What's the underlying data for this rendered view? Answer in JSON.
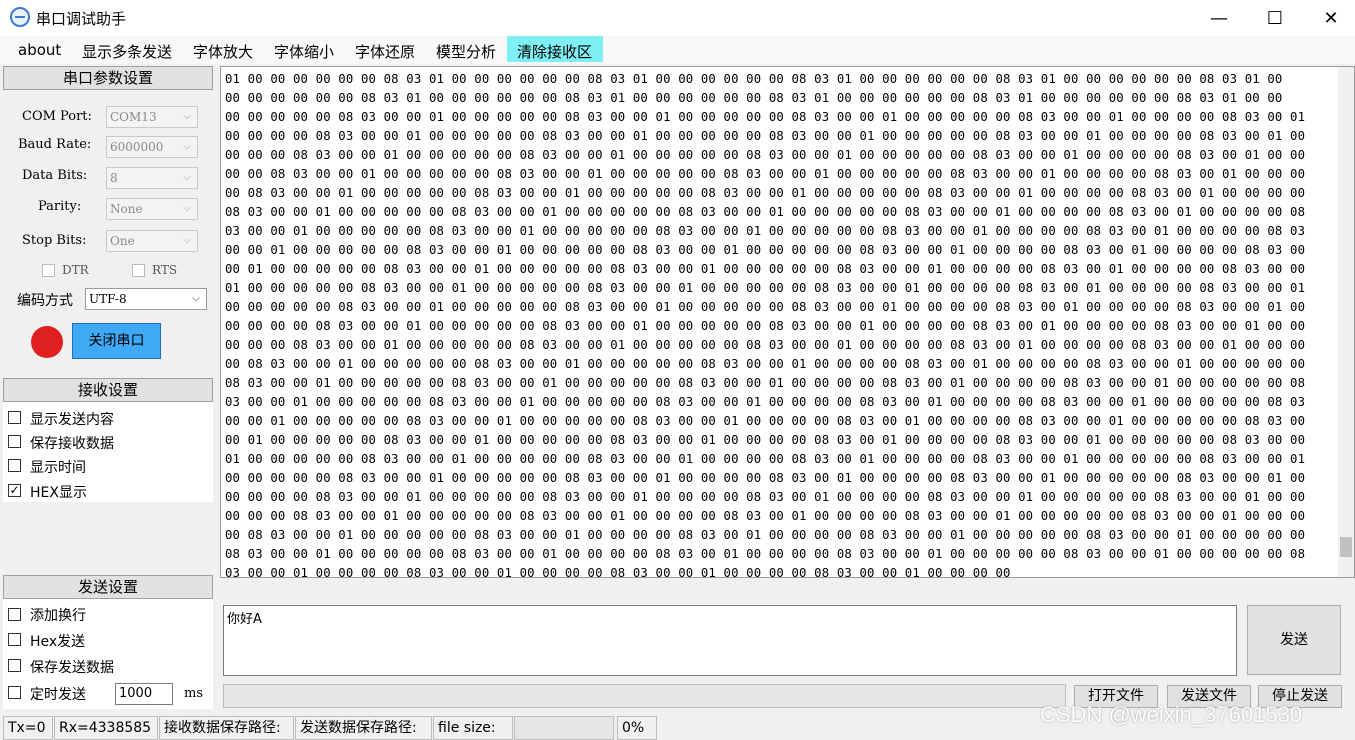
{
  "window": {
    "title": "串口调试助手",
    "minimize": "—",
    "maximize": "☐",
    "close": "✕"
  },
  "menu": [
    "about",
    "显示多条发送",
    "字体放大",
    "字体缩小",
    "字体还原",
    "模型分析",
    "清除接收区"
  ],
  "serial_settings": {
    "header": "串口参数设置",
    "com_port_label": "COM Port:",
    "com_port_value": "COM13",
    "baud_rate_label": "Baud Rate:",
    "baud_rate_value": "6000000",
    "data_bits_label": "Data Bits:",
    "data_bits_value": "8",
    "parity_label": "Parity:",
    "parity_value": "None",
    "stop_bits_label": "Stop Bits:",
    "stop_bits_value": "One",
    "dtr_label": "DTR",
    "rts_label": "RTS",
    "encoding_label": "编码方式",
    "encoding_value": "UTF-8",
    "close_port_button": "关闭串口",
    "status_color": "#e02020"
  },
  "receive_settings": {
    "header": "接收设置",
    "options": [
      {
        "label": "显示发送内容",
        "checked": false
      },
      {
        "label": "保存接收数据",
        "checked": false
      },
      {
        "label": "显示时间",
        "checked": false
      },
      {
        "label": "HEX显示",
        "checked": true
      }
    ]
  },
  "send_settings": {
    "header": "发送设置",
    "options": [
      {
        "label": "添加换行",
        "checked": false
      },
      {
        "label": "Hex发送",
        "checked": false
      },
      {
        "label": "保存发送数据",
        "checked": false
      },
      {
        "label": "定时发送",
        "checked": false
      }
    ],
    "interval_value": "1000",
    "interval_unit": "ms"
  },
  "receive_area": {
    "lines": [
      "01 00 00 00 00 00 00 08 03 01 00 00 00 00 00 00 08 03 01 00 00 00 00 00 00 08 03 01 00 00 00 00 00 00 08 03 01 00 00 00 00 00 00 08 03 01 00",
      "00 00 00 00 00 00 08 03 01 00 00 00 00 00 00 08 03 01 00 00 00 00 00 00 08 03 01 00 00 00 00 00 00 08 03 01 00 00 00 00 00 00 08 03 01 00 00",
      "00 00 00 00 00 08 03 00 00 01 00 00 00 00 00 08 03 00 00 01 00 00 00 00 00 08 03 00 00 01 00 00 00 00 00 08 03 00 00 01 00 00 00 00 08 03 00 01",
      "00 00 00 00 08 03 00 00 01 00 00 00 00 00 08 03 00 00 01 00 00 00 00 00 08 03 00 00 01 00 00 00 00 00 08 03 00 00 01 00 00 00 00 08 03 00 01 00",
      "00 00 00 08 03 00 00 01 00 00 00 00 00 08 03 00 00 01 00 00 00 00 00 08 03 00 00 01 00 00 00 00 00 08 03 00 00 01 00 00 00 00 08 03 00 01 00 00",
      "00 00 08 03 00 00 01 00 00 00 00 00 08 03 00 00 01 00 00 00 00 00 08 03 00 00 01 00 00 00 00 00 08 03 00 00 01 00 00 00 00 08 03 00 01 00 00 00",
      "00 08 03 00 00 01 00 00 00 00 00 08 03 00 00 01 00 00 00 00 00 08 03 00 00 01 00 00 00 00 00 08 03 00 00 01 00 00 00 00 08 03 00 01 00 00 00 00",
      "08 03 00 00 01 00 00 00 00 00 08 03 00 00 01 00 00 00 00 00 08 03 00 00 01 00 00 00 00 00 08 03 00 00 01 00 00 00 00 08 03 00 01 00 00 00 00 08",
      "03 00 00 01 00 00 00 00 00 08 03 00 00 01 00 00 00 00 00 08 03 00 00 01 00 00 00 00 00 08 03 00 00 01 00 00 00 00 08 03 00 01 00 00 00 00 08 03",
      "00 00 01 00 00 00 00 00 08 03 00 00 01 00 00 00 00 00 08 03 00 00 01 00 00 00 00 00 08 03 00 00 01 00 00 00 00 08 03 00 01 00 00 00 00 08 03 00",
      "00 01 00 00 00 00 00 08 03 00 00 01 00 00 00 00 00 08 03 00 00 01 00 00 00 00 00 08 03 00 00 01 00 00 00 00 08 03 00 01 00 00 00 00 08 03 00 00",
      "01 00 00 00 00 00 08 03 00 00 01 00 00 00 00 00 08 03 00 00 01 00 00 00 00 00 08 03 00 00 01 00 00 00 00 08 03 00 01 00 00 00 00 08 03 00 00 01",
      "00 00 00 00 00 08 03 00 00 01 00 00 00 00 00 08 03 00 00 01 00 00 00 00 00 08 03 00 00 01 00 00 00 00 08 03 00 01 00 00 00 00 08 03 00 00 01 00",
      "00 00 00 00 08 03 00 00 01 00 00 00 00 00 08 03 00 00 01 00 00 00 00 00 08 03 00 00 01 00 00 00 00 08 03 00 01 00 00 00 00 08 03 00 00 01 00 00",
      "00 00 00 08 03 00 00 01 00 00 00 00 00 08 03 00 00 01 00 00 00 00 00 08 03 00 00 01 00 00 00 00 08 03 00 01 00 00 00 00 08 03 00 00 01 00 00 00",
      "00 08 03 00 00 01 00 00 00 00 00 08 03 00 00 01 00 00 00 00 00 08 03 00 00 01 00 00 00 00 08 03 00 01 00 00 00 00 08 03 00 00 01 00 00 00 00 00",
      "08 03 00 00 01 00 00 00 00 00 08 03 00 00 01 00 00 00 00 00 08 03 00 00 01 00 00 00 00 08 03 00 01 00 00 00 00 08 03 00 00 01 00 00 00 00 00 08",
      "03 00 00 01 00 00 00 00 00 08 03 00 00 01 00 00 00 00 00 08 03 00 00 01 00 00 00 00 08 03 00 01 00 00 00 00 08 03 00 00 01 00 00 00 00 00 08 03",
      "00 00 01 00 00 00 00 00 08 03 00 00 01 00 00 00 00 00 08 03 00 00 01 00 00 00 00 08 03 00 01 00 00 00 00 08 03 00 00 01 00 00 00 00 00 08 03 00",
      "00 01 00 00 00 00 00 08 03 00 00 01 00 00 00 00 00 08 03 00 00 01 00 00 00 00 08 03 00 01 00 00 00 00 08 03 00 00 01 00 00 00 00 00 08 03 00 00",
      "01 00 00 00 00 00 08 03 00 00 01 00 00 00 00 00 08 03 00 00 01 00 00 00 00 08 03 00 01 00 00 00 00 08 03 00 00 01 00 00 00 00 00 08 03 00 00 01",
      "00 00 00 00 00 08 03 00 00 01 00 00 00 00 00 08 03 00 00 01 00 00 00 00 08 03 00 01 00 00 00 00 08 03 00 00 01 00 00 00 00 00 08 03 00 00 01 00",
      "00 00 00 00 08 03 00 00 01 00 00 00 00 00 08 03 00 00 01 00 00 00 00 08 03 00 01 00 00 00 00 08 03 00 00 01 00 00 00 00 00 08 03 00 00 01 00 00",
      "00 00 00 08 03 00 00 01 00 00 00 00 00 08 03 00 00 01 00 00 00 00 08 03 00 01 00 00 00 00 08 03 00 00 01 00 00 00 00 00 08 03 00 00 01 00 00 00",
      "00 08 03 00 00 01 00 00 00 00 00 08 03 00 00 01 00 00 00 00 08 03 00 01 00 00 00 00 08 03 00 00 01 00 00 00 00 00 08 03 00 00 01 00 00 00 00 00",
      "08 03 00 00 01 00 00 00 00 00 08 03 00 00 01 00 00 00 00 08 03 00 01 00 00 00 00 08 03 00 00 01 00 00 00 00 00 08 03 00 00 01 00 00 00 00 00 08",
      "03 00 00 01 00 00 00 00 08 03 00 00 01 00 00 00 00 08 03 00 00 01 00 00 00 00 08 03 00 00 01 00 00 00 00"
    ]
  },
  "send_area": {
    "text": "你好A",
    "send_button": "发送",
    "open_file_button": "打开文件",
    "send_file_button": "发送文件",
    "stop_send_button": "停止发送"
  },
  "status_bar": {
    "tx": "Tx=0",
    "rx": "Rx=4338585",
    "recv_path_label": "接收数据保存路径:",
    "send_path_label": "发送数据保存路径:",
    "file_size_label": "file size:",
    "progress_text": "0%",
    "progress": 0
  },
  "watermark": "CSDN @weixin_37601530"
}
